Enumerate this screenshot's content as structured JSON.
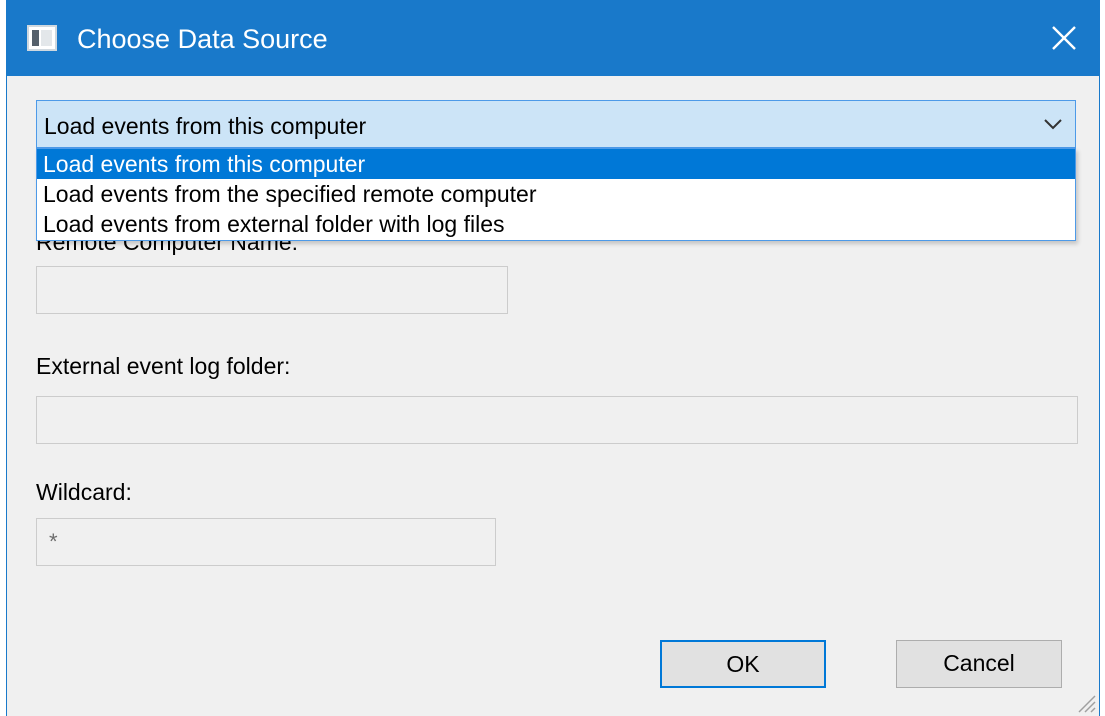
{
  "window": {
    "title": "Choose Data Source",
    "accent_color": "#1979ca",
    "icons": {
      "app": "event-viewer-app-icon",
      "close": "close-icon"
    }
  },
  "source_select": {
    "value": "Load events from this computer",
    "icon": "chevron-down-icon",
    "options": [
      "Load events from this computer",
      "Load events from the specified remote computer",
      "Load events from external folder with log files"
    ],
    "selected_index": 0,
    "highlight_color": "#0078d7"
  },
  "remote_computer": {
    "label": "Remote Computer Name:",
    "value": ""
  },
  "external_folder": {
    "label": "External event log folder:",
    "value": ""
  },
  "wildcard": {
    "label": "Wildcard:",
    "value": "*"
  },
  "buttons": {
    "ok": "OK",
    "cancel": "Cancel"
  }
}
